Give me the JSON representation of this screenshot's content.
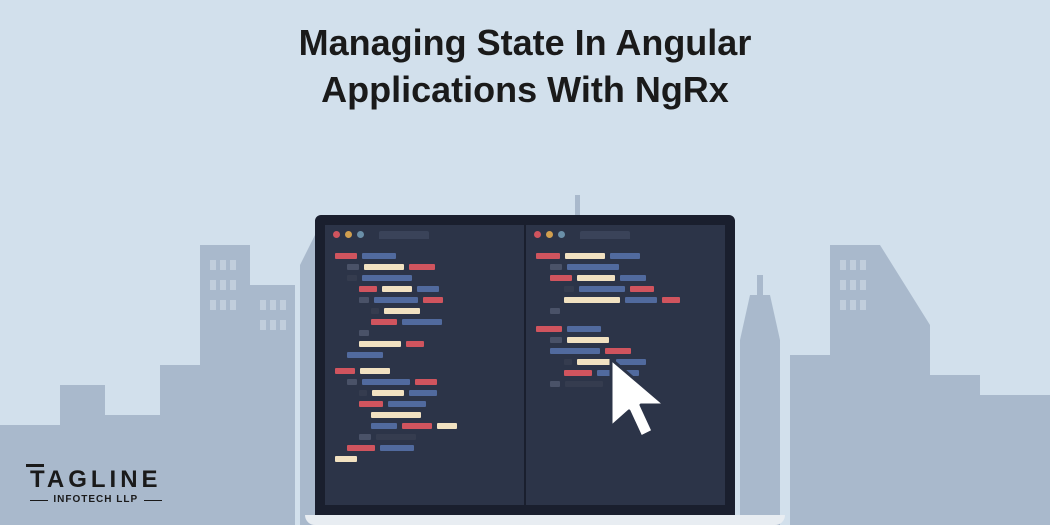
{
  "title_line1": "Managing State In Angular",
  "title_line2": "Applications With NgRx",
  "logo_main": "TAGLINE",
  "logo_sub": "INFOTECH LLP",
  "colors": {
    "bg": "#d2e0ec",
    "skyline": "#a9b9cc",
    "screen_bg": "#2c3448",
    "border": "#1a1f2e"
  }
}
